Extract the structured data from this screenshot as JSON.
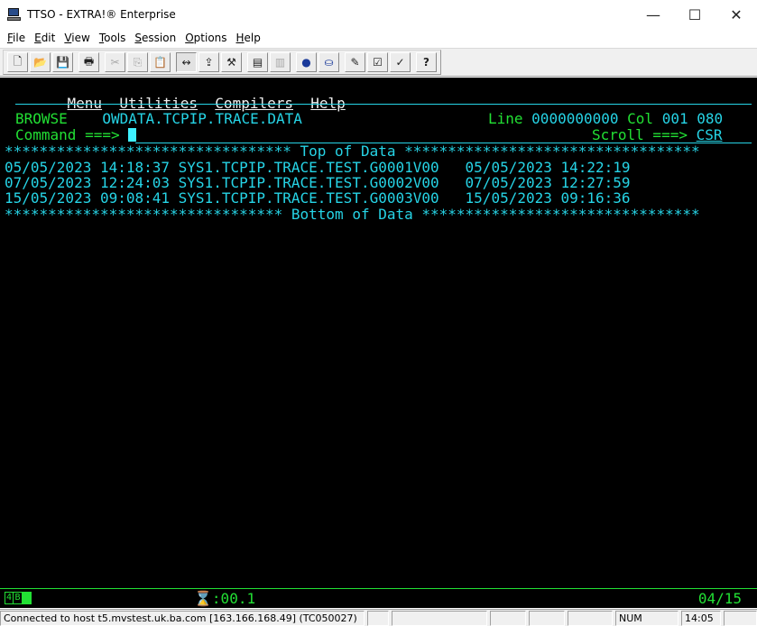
{
  "window": {
    "title": "TTSO - EXTRA!® Enterprise",
    "controls": {
      "minimize": "—",
      "maximize": "☐",
      "close": "✕"
    }
  },
  "menu": {
    "items": [
      {
        "first": "F",
        "rest": "ile"
      },
      {
        "first": "E",
        "rest": "dit"
      },
      {
        "first": "V",
        "rest": "iew"
      },
      {
        "first": "T",
        "rest": "ools"
      },
      {
        "first": "S",
        "rest": "ession"
      },
      {
        "first": "O",
        "rest": "ptions"
      },
      {
        "first": "H",
        "rest": "elp"
      }
    ]
  },
  "toolbar": {
    "icons": [
      "new-icon",
      "open-icon",
      "save-icon",
      "print-icon",
      "cut-icon",
      "copy-icon",
      "paste-icon",
      "connect-icon",
      "macro-icon",
      "tools-icon",
      "screen-icon",
      "screen2-icon",
      "record-icon",
      "transfer-icon",
      "edit-icon",
      "edit2-icon",
      "check-icon",
      "help-cursor-icon"
    ],
    "glyphs": [
      "🗋",
      "📂",
      "💾",
      "🖶",
      "✂",
      "⎘",
      "📋",
      "↭",
      "⇪",
      "⚒",
      "▤",
      "▥",
      "●",
      "⛀",
      "✎",
      "☑",
      "✓",
      "?"
    ]
  },
  "terminal": {
    "menu_bar": [
      "Menu",
      "Utilities",
      "Compilers",
      "Help"
    ],
    "mode": "BROWSE",
    "dataset": "OWDATA.TCPIP.TRACE.DATA",
    "line_label": "Line",
    "line_value": "0000000000",
    "col_label": "Col",
    "col_value": "001 080",
    "command_label": "Command ===>",
    "scroll_label": "Scroll ===>",
    "scroll_value": "CSR",
    "top_banner": "********************************* Top of Data **********************************",
    "rows": [
      "05/05/2023 14:18:37 SYS1.TCPIP.TRACE.TEST.G0001V00   05/05/2023 14:22:19",
      "07/05/2023 12:24:03 SYS1.TCPIP.TRACE.TEST.G0002V00   07/05/2023 12:27:59",
      "15/05/2023 09:08:41 SYS1.TCPIP.TRACE.TEST.G0003V00   15/05/2023 09:16:36"
    ],
    "bottom_banner": "******************************** Bottom of Data ********************************"
  },
  "oia": {
    "box1": "4",
    "box2": "B",
    "timer": "⌛:00.1",
    "cursor_pos": "04/15"
  },
  "statusbar": {
    "connection": "Connected to host t5.mvstest.uk.ba.com [163.166.168.49] (TC050027)",
    "num": "NUM",
    "time": "14:05"
  },
  "colors": {
    "terminal_bg": "#000000",
    "cyan": "#26d4e6",
    "green": "#22e034",
    "white": "#f0f0f0"
  }
}
